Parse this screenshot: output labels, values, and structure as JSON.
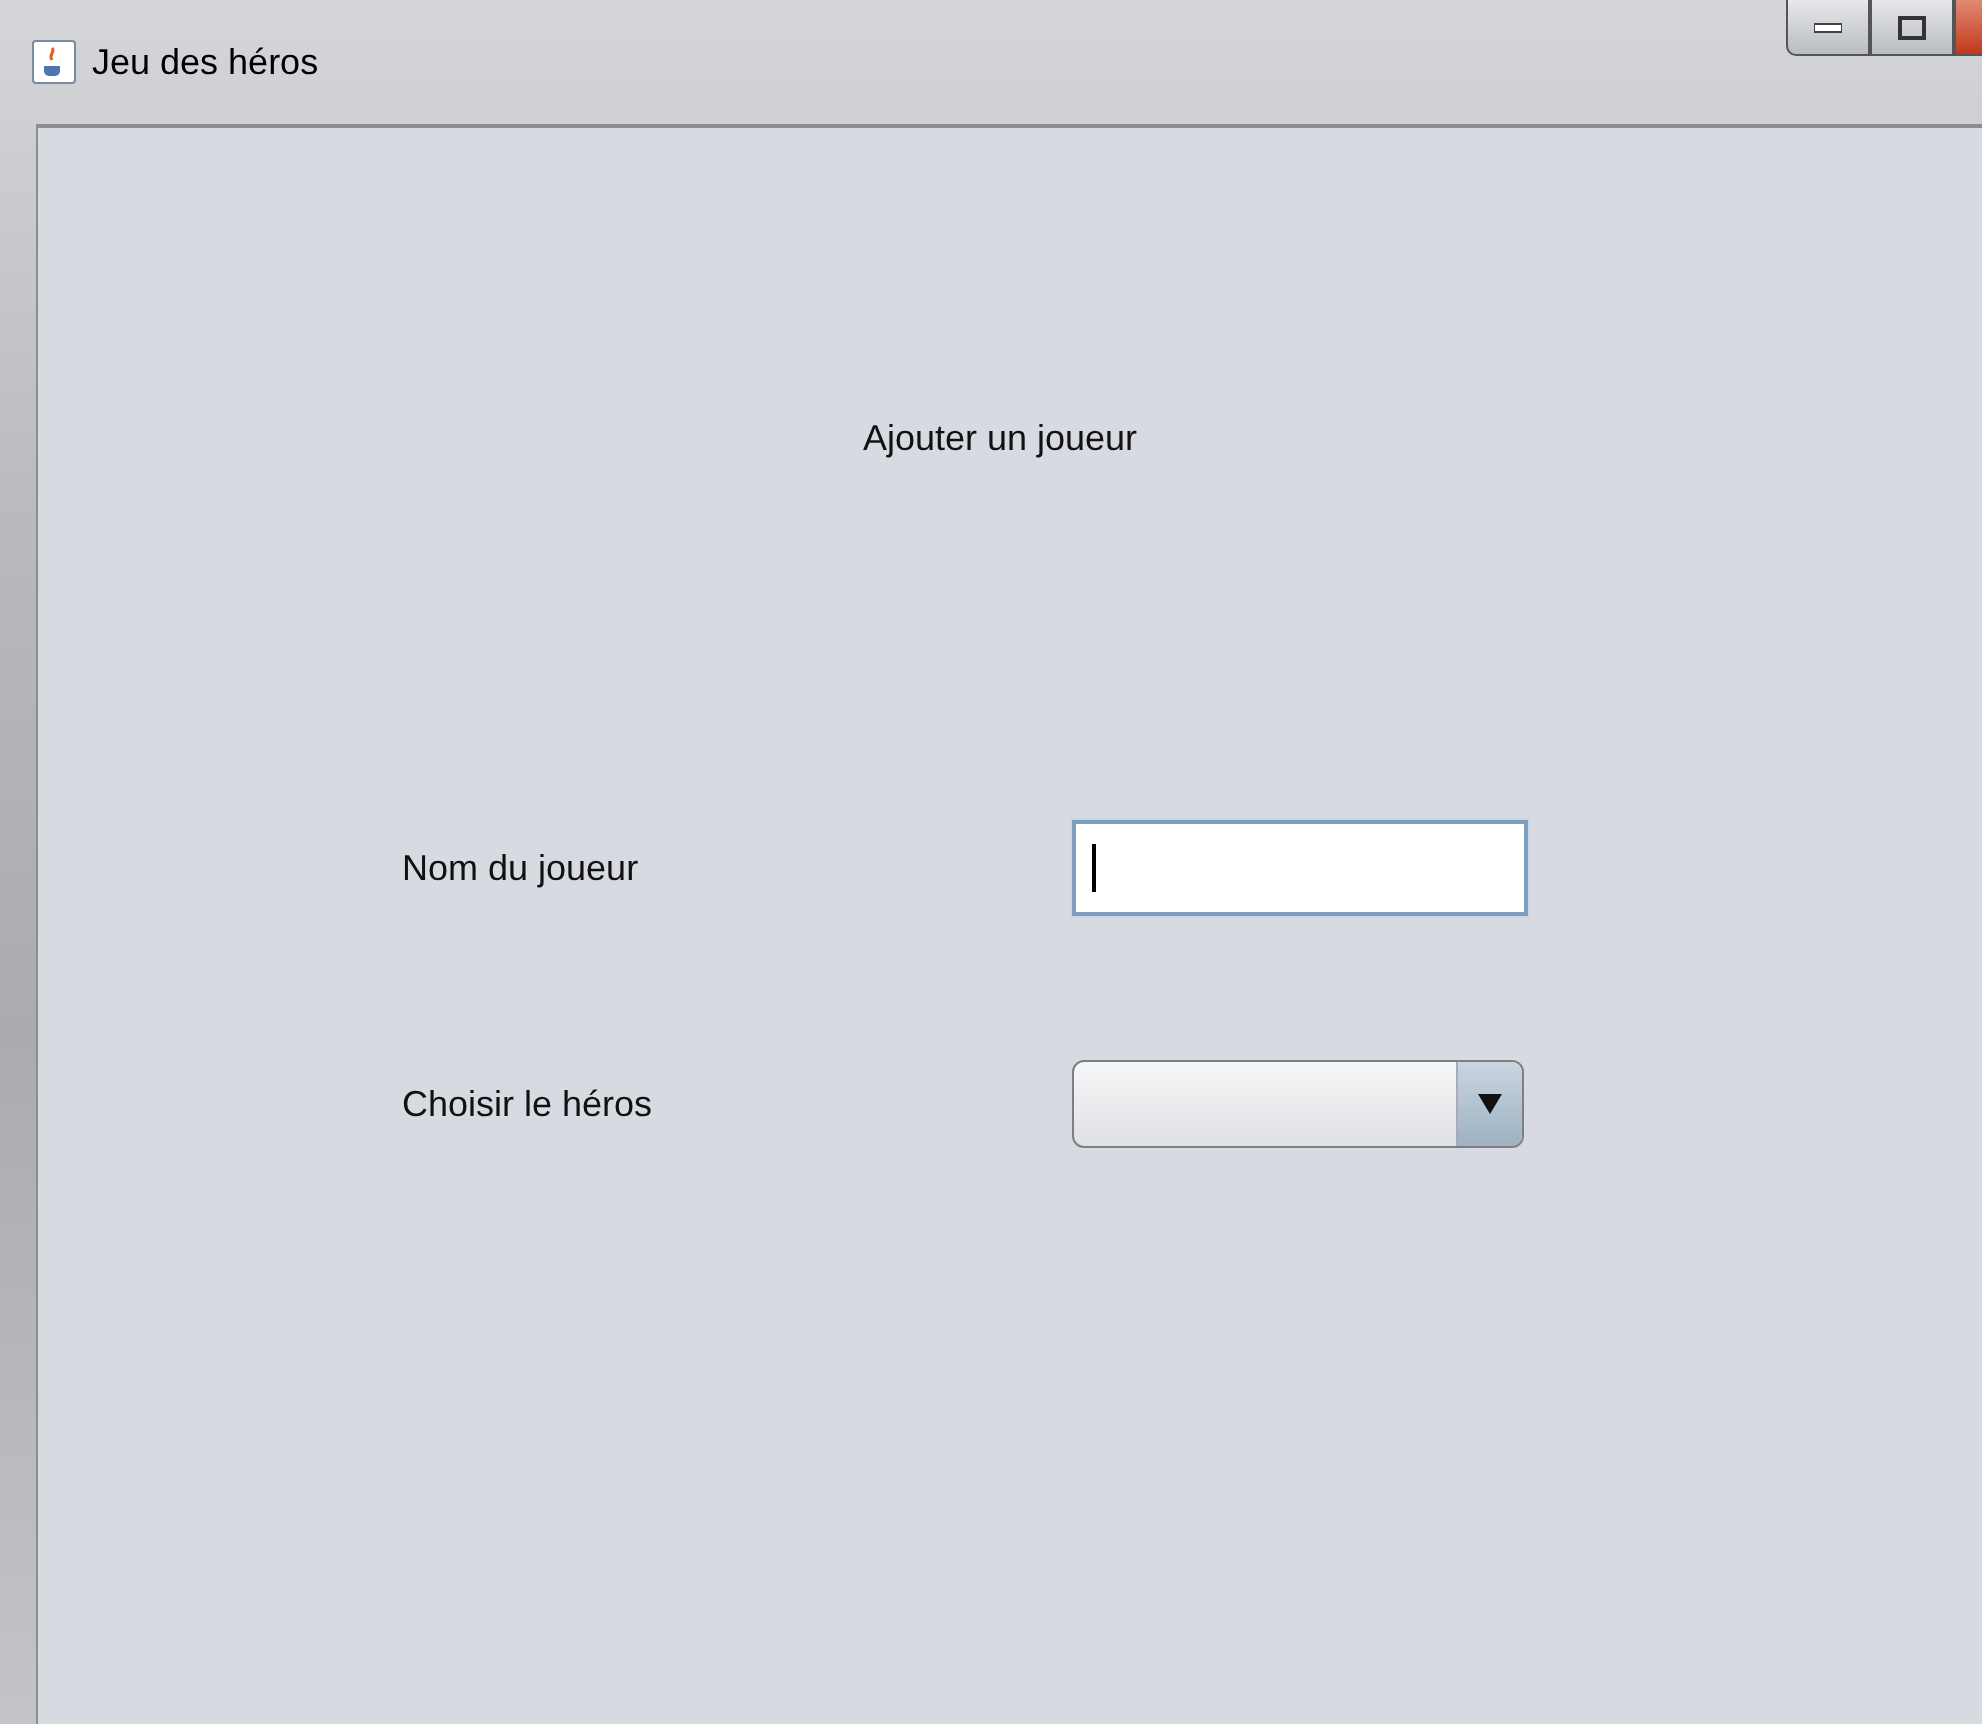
{
  "window": {
    "title": "Jeu des héros"
  },
  "heading": "Ajouter un joueur",
  "fields": [
    {
      "label": "Nom du joueur",
      "kind": "text",
      "focused": true
    },
    {
      "label": "Choisir le héros",
      "kind": "combo",
      "focused": false
    }
  ]
}
